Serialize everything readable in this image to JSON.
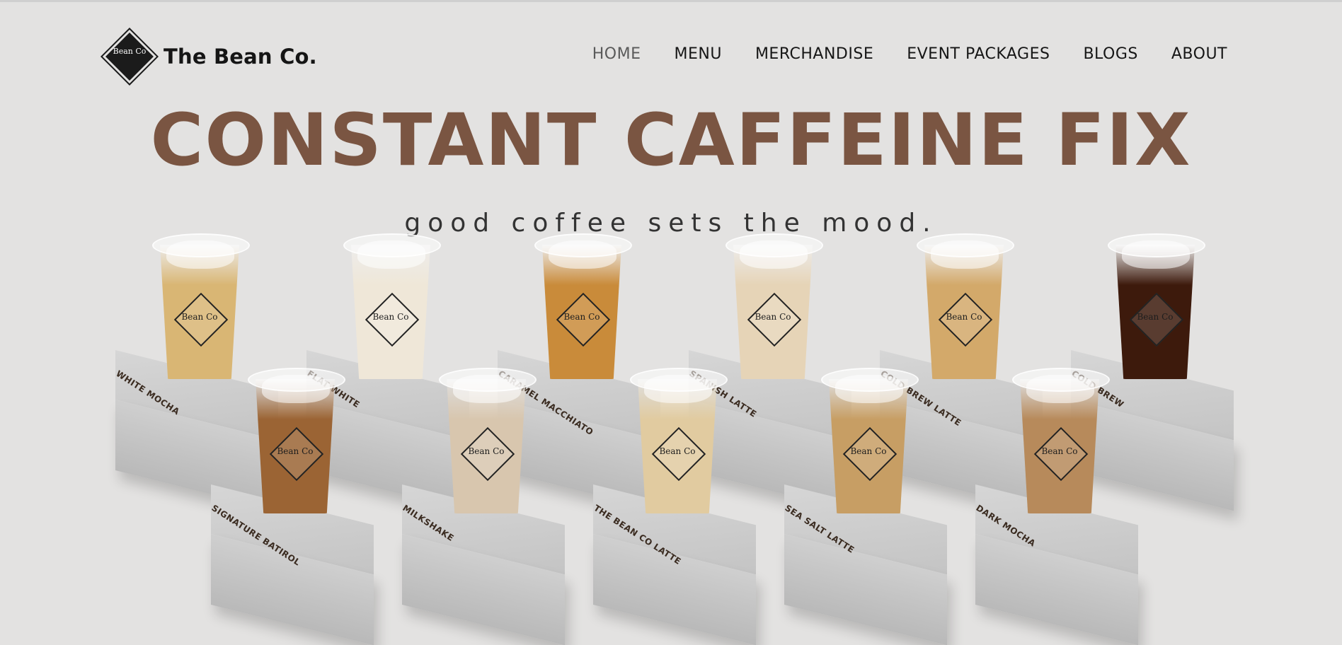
{
  "brand": {
    "name": "The Bean Co.",
    "logo_text": "Bean Co"
  },
  "nav": [
    {
      "label": "HOME",
      "active": true
    },
    {
      "label": "MENU"
    },
    {
      "label": "MERCHANDISE"
    },
    {
      "label": "EVENT PACKAGES"
    },
    {
      "label": "BLOGS"
    },
    {
      "label": "ABOUT"
    }
  ],
  "hero": {
    "title": "CONSTANT CAFFEINE FIX",
    "subtitle": "good coffee sets the mood."
  },
  "drinks": [
    {
      "name": "WHITE MOCHA",
      "color": "#d9b674"
    },
    {
      "name": "FLAT WHITE",
      "color": "#efe7d8"
    },
    {
      "name": "CARAMEL MACCHIATO",
      "color": "#c98b3a"
    },
    {
      "name": "SPANISH LATTE",
      "color": "#e6d4b7"
    },
    {
      "name": "COLD BREW LATTE",
      "color": "#d3a96a"
    },
    {
      "name": "COLD BREW",
      "color": "#3d1a0c"
    },
    {
      "name": "SIGNATURE BATIROL",
      "color": "#9b6434"
    },
    {
      "name": "MILKSHAKE",
      "color": "#d8c6ae"
    },
    {
      "name": "THE BEAN CO LATTE",
      "color": "#e1cba0"
    },
    {
      "name": "SEA SALT LATTE",
      "color": "#c79e64"
    },
    {
      "name": "DARK MOCHA",
      "color": "#b78a5b"
    }
  ],
  "colors": {
    "accent": "#7a5542",
    "background": "#e3e2e1"
  }
}
